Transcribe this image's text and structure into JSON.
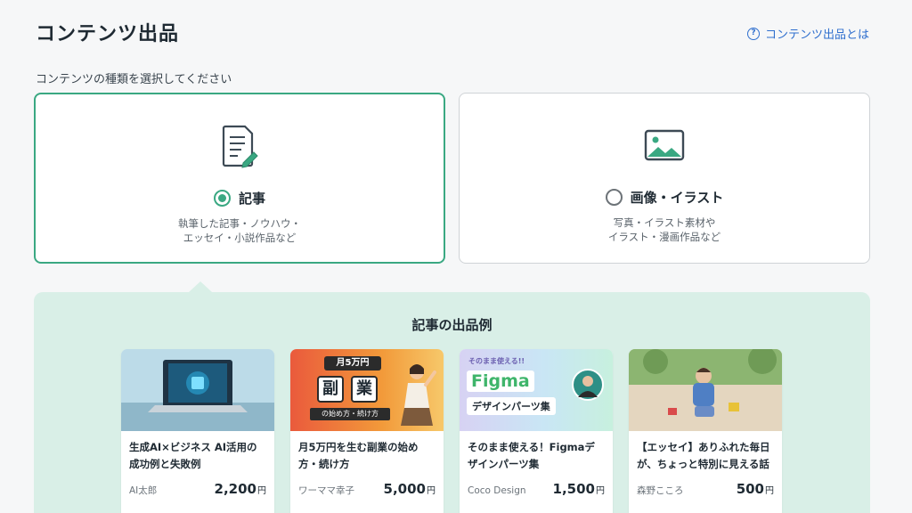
{
  "header": {
    "title": "コンテンツ出品",
    "help_link": "コンテンツ出品とは",
    "help_icon": "question-circle-icon"
  },
  "selector": {
    "prompt": "コンテンツの種類を選択してください",
    "options": [
      {
        "label": "記事",
        "description": "執筆した記事・ノウハウ・\nエッセイ・小説作品など",
        "icon": "document-edit-icon",
        "selected": true
      },
      {
        "label": "画像・イラスト",
        "description": "写真・イラスト素材や\nイラスト・漫画作品など",
        "icon": "image-icon",
        "selected": false
      }
    ]
  },
  "examples": {
    "title": "記事の出品例",
    "currency": "円",
    "items": [
      {
        "title": "生成AI×ビジネス AI活用の成功例と失敗例",
        "author": "AI太郎",
        "price": "2,200"
      },
      {
        "title": "月5万円を生む副業の始め方・続け方",
        "author": "ワーママ幸子",
        "price": "5,000",
        "thumb_text": {
          "badge": "月5万円",
          "word1": "副",
          "word2": "業",
          "caption": "の始め方・続け方"
        }
      },
      {
        "title": "そのまま使える！Figmaデザインパーツ集",
        "author": "Coco Design",
        "price": "1,500",
        "thumb_text": {
          "top": "そのまま使える!!",
          "brand": "Figma",
          "caption": "デザインパーツ集"
        }
      },
      {
        "title": "【エッセイ】ありふれた毎日が、ちょっと特別に見える話",
        "author": "森野こころ",
        "price": "500"
      }
    ]
  },
  "colors": {
    "accent": "#3aa882",
    "link": "#2f6fce",
    "panel": "#d9efe7"
  }
}
